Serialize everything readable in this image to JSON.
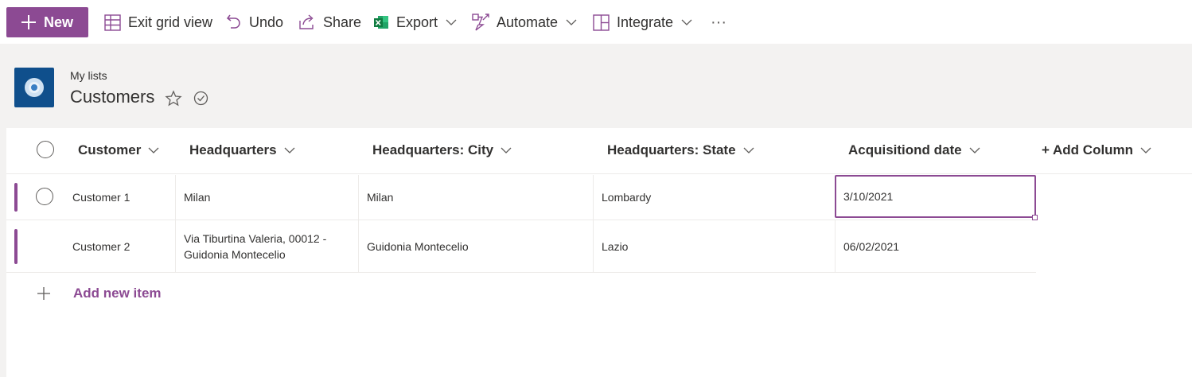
{
  "toolbar": {
    "new_label": "New",
    "exit_grid_label": "Exit grid view",
    "undo_label": "Undo",
    "share_label": "Share",
    "export_label": "Export",
    "automate_label": "Automate",
    "integrate_label": "Integrate",
    "more_label": "···"
  },
  "header": {
    "breadcrumb": "My lists",
    "title": "Customers"
  },
  "columns": {
    "customer": "Customer",
    "headquarters": "Headquarters",
    "city": "Headquarters: City",
    "state": "Headquarters: State",
    "acquisition": "Acquisitiond date",
    "add_column": "+ Add Column"
  },
  "rows": [
    {
      "customer": "Customer 1",
      "headquarters": "Milan",
      "city": "Milan",
      "state": "Lombardy",
      "acquisition": "3/10/2021"
    },
    {
      "customer": "Customer 2",
      "headquarters": "Via Tiburtina Valeria, 00012 - Guidonia Montecelio",
      "city": "Guidonia Montecelio",
      "state": "Lazio",
      "acquisition": "06/02/2021"
    }
  ],
  "add_item_label": "Add new item",
  "colors": {
    "accent": "#8c4a93",
    "site_logo": "#0f4f8c",
    "background": "#f3f2f1",
    "excel_green": "#107c41"
  }
}
